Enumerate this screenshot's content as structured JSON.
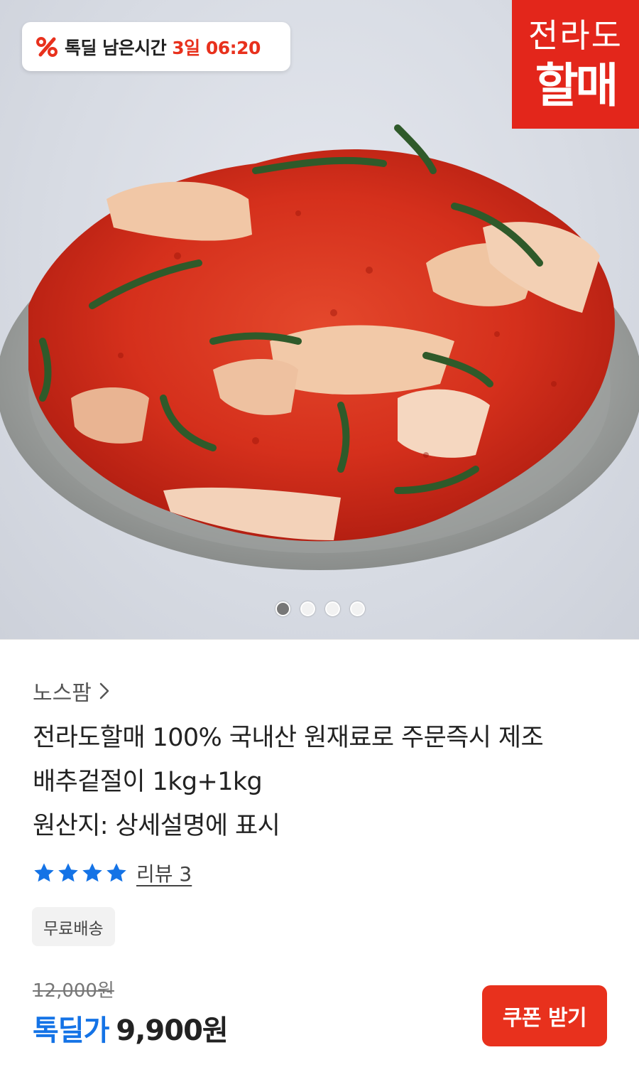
{
  "hero": {
    "image_alt": "",
    "carousel": {
      "count": 4,
      "active_index": 0
    }
  },
  "timer": {
    "icon": "percent-icon",
    "label": "톡딜 남은시간",
    "remaining": "3일 06:20"
  },
  "brand_stamp": {
    "line1": "전라도",
    "line2": "할매"
  },
  "product": {
    "seller": "노스팜",
    "title_line1": "전라도할매 100% 국내산 원재료로 주문즉시 제조",
    "title_line2": "배추겉절이 1kg+1kg",
    "title_line3": "원산지: 상세설명에 표시",
    "rating": {
      "stars": 4,
      "icon": "star-icon"
    },
    "review_label": "리뷰 3",
    "shipping_badge": "무료배송",
    "original_price": "12,000원",
    "deal_label": "톡딜가",
    "deal_price": "9,900원",
    "coupon_button": "쿠폰 받기"
  },
  "colors": {
    "accent_red": "#e8311d",
    "deal_blue": "#1473e6",
    "star_blue": "#1473e6",
    "stamp_red": "#e3261b"
  }
}
